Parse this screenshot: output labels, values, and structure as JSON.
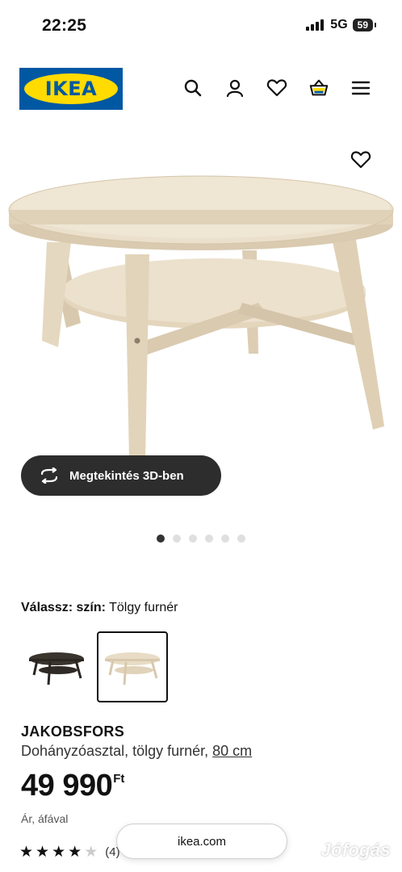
{
  "status": {
    "time": "22:25",
    "network": "5G",
    "battery": "59"
  },
  "header": {
    "logo_text": "IKEA",
    "icons": [
      "search-icon",
      "user-icon",
      "heart-icon",
      "cart-icon",
      "menu-icon"
    ]
  },
  "gallery": {
    "view3d_label": "Megtekintés 3D-ben",
    "slide_count": 6,
    "active_slide": 1
  },
  "color": {
    "label": "Válassz: szín:",
    "value": "Tölgy furnér",
    "options": [
      "dark-brown",
      "oak-veneer"
    ],
    "selected": "oak-veneer"
  },
  "product": {
    "name": "JAKOBSFORS",
    "description": "Dohányzóasztal, tölgy furnér,",
    "size_link": "80 cm",
    "price": "49 990",
    "currency": "Ft",
    "vat_note": "Ár, áfával",
    "rating": 4,
    "review_count": "(4)"
  },
  "browser": {
    "url": "ikea.com"
  },
  "watermark": "Jófogás",
  "colors": {
    "ikea_blue": "#0058a3",
    "ikea_yellow": "#ffdb00",
    "wood": "#e6d9c3"
  }
}
